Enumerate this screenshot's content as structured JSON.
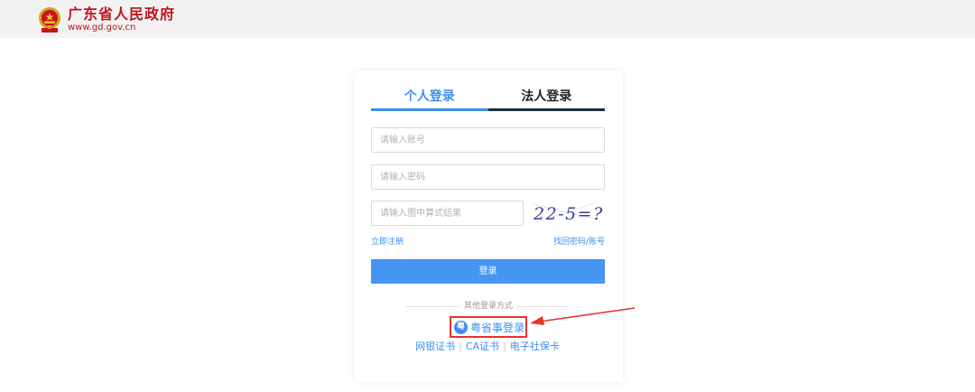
{
  "header": {
    "site_name": "广东省人民政府",
    "site_url": "www.gd.gov.cn",
    "emblem_icon": "national-emblem-icon"
  },
  "login": {
    "tabs": [
      {
        "label": "个人登录",
        "active": true
      },
      {
        "label": "法人登录",
        "active": false
      }
    ],
    "account_placeholder": "请输入账号",
    "password_placeholder": "请输入密码",
    "captcha_placeholder": "请输入图中算式结果",
    "captcha_text": "22-5=?",
    "register_link": "立即注册",
    "forgot_link": "找回密码/账号",
    "submit_label": "登录",
    "other_methods_label": "其他登录方式",
    "yueshengshi_label": "粤省事登录",
    "yueshengshi_icon": "yueshengshi-icon",
    "alt_methods": [
      "网银证书",
      "CA证书",
      "电子社保卡"
    ]
  },
  "colors": {
    "accent": "#3e8ef0",
    "button": "#4596f2",
    "brand_red": "#c0141b",
    "annotation_red": "#e3352b"
  }
}
